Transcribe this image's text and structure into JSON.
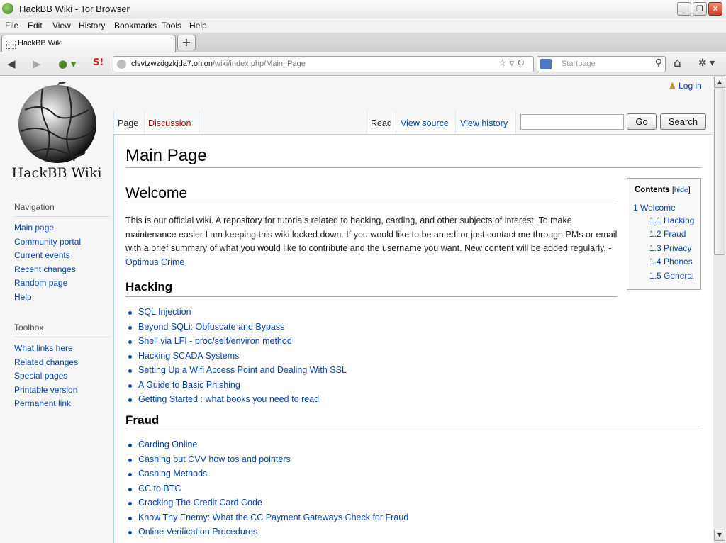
{
  "window": {
    "title": "HackBB Wiki - Tor Browser"
  },
  "menu": [
    "File",
    "Edit",
    "View",
    "History",
    "Bookmarks",
    "Tools",
    "Help"
  ],
  "tab": {
    "label": "HackBB Wiki",
    "new_tab": "+"
  },
  "address": {
    "host": "clsvtzwzdgzkjda7.onion",
    "path": "/wiki/index.php/Main_Page"
  },
  "search_engine": {
    "placeholder": "Startpage"
  },
  "wiki": {
    "logo_text": "HackBB Wiki",
    "login": "Log in",
    "tabs": {
      "page": "Page",
      "discussion": "Discussion",
      "read": "Read",
      "view_source": "View source",
      "view_history": "View history"
    },
    "search_buttons": {
      "go": "Go",
      "search": "Search"
    },
    "navigation": {
      "heading": "Navigation",
      "items": [
        "Main page",
        "Community portal",
        "Current events",
        "Recent changes",
        "Random page",
        "Help"
      ]
    },
    "toolbox": {
      "heading": "Toolbox",
      "items": [
        "What links here",
        "Related changes",
        "Special pages",
        "Printable version",
        "Permanent link"
      ]
    },
    "title": "Main Page",
    "welcome_heading": "Welcome",
    "intro": "This is our official wiki. A repository for tutorials related to hacking, carding, and other subjects of interest. To make maintenance easier I am keeping this wiki locked down. If you would like to be an editor just contact me through PMs or email with a brief summary of what you would like to contribute and the username you want. New content will be added regularly. - ",
    "intro_author": "Optimus Crime",
    "toc": {
      "title": "Contents",
      "hide_open": "[",
      "hide_label": "hide",
      "hide_close": "]",
      "items": [
        "1 Welcome",
        "1.1 Hacking",
        "1.2 Fraud",
        "1.3 Privacy",
        "1.4 Phones",
        "1.5 General"
      ]
    },
    "hacking": {
      "heading": "Hacking",
      "links": [
        "SQL Injection",
        "Beyond SQLi: Obfuscate and Bypass",
        "Shell via LFI - proc/self/environ method",
        "Hacking SCADA Systems",
        "Setting Up a Wifi Access Point and Dealing With SSL",
        "A Guide to Basic Phishing",
        "Getting Started : what books you need to read"
      ]
    },
    "fraud": {
      "heading": "Fraud",
      "links": [
        "Carding Online",
        "Cashing out CVV how tos and pointers",
        "Cashing Methods",
        "CC to BTC",
        "Cracking The Credit Card Code",
        "Know Thy Enemy: What the CC Payment Gateways Check for Fraud",
        "Online Verification Procedures"
      ]
    }
  },
  "colors": {
    "link": "#0645ad",
    "tab_border": "#a7d7f9"
  }
}
